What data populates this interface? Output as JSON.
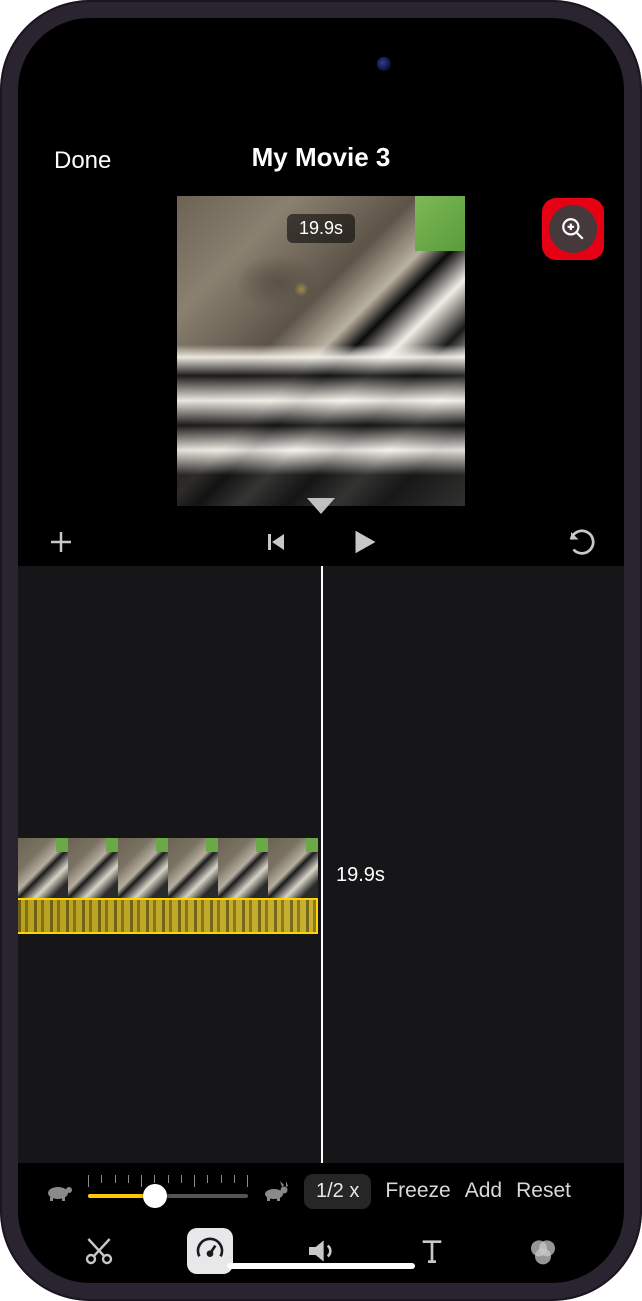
{
  "header": {
    "done_label": "Done",
    "title": "My Movie 3"
  },
  "preview": {
    "duration_badge": "19.9s"
  },
  "timeline": {
    "duration_label": "19.9s"
  },
  "speed": {
    "multiplier_label": "1/2 x",
    "freeze_label": "Freeze",
    "add_label": "Add",
    "reset_label": "Reset",
    "slider_fill_pct": 42
  },
  "icons": {
    "zoom": "zoom-in-icon",
    "add": "plus-icon",
    "skip_start": "skip-start-icon",
    "play": "play-icon",
    "undo": "undo-icon",
    "turtle": "turtle-icon",
    "rabbit": "rabbit-icon",
    "scissors": "scissors-icon",
    "speedometer": "speedometer-icon",
    "speaker": "speaker-icon",
    "text": "text-icon",
    "filters": "filters-icon"
  }
}
